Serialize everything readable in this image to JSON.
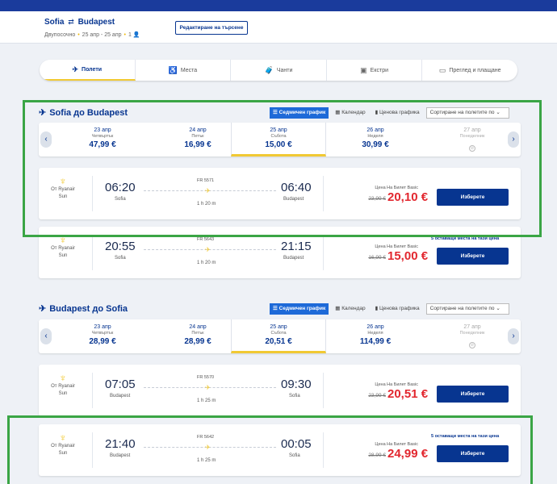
{
  "header": {
    "from": "Sofia",
    "to": "Budapest",
    "arrows": "⇄",
    "trip_type": "Двупосочно",
    "dates": "25 апр - 25 апр",
    "pax": "1",
    "edit_label": "Редактиране на търсене"
  },
  "steps": [
    {
      "label": "Полети",
      "icon": "plane-icon"
    },
    {
      "label": "Места",
      "icon": "seat-icon"
    },
    {
      "label": "Чанти",
      "icon": "bag-icon"
    },
    {
      "label": "Екстри",
      "icon": "extras-icon"
    },
    {
      "label": "Преглед и плащане",
      "icon": "card-icon"
    }
  ],
  "outbound": {
    "title": "Sofia до Budapest",
    "tools": {
      "weekly": "Седмичен график",
      "calendar": "Календар",
      "price_chart": "Ценова графика",
      "sort": "Сортиране на полетите по"
    },
    "dates": [
      {
        "date": "23 апр",
        "weekday": "Четвъртък",
        "price": "47,99 €"
      },
      {
        "date": "24 апр",
        "weekday": "Петък",
        "price": "16,99 €"
      },
      {
        "date": "25 апр",
        "weekday": "Събота",
        "price": "15,00 €"
      },
      {
        "date": "26 апр",
        "weekday": "Неделя",
        "price": "30,99 €"
      },
      {
        "date": "27 апр",
        "weekday": "Понеделник",
        "price": ""
      }
    ],
    "flights": [
      {
        "airline": "От Ryanair",
        "airline2": "Sun",
        "dep": "06:20",
        "from": "Sofia",
        "arr": "06:40",
        "to": "Budapest",
        "number": "FR 5571",
        "duration": "1 h 20 m",
        "fare_label": "Цена На Билет Basic",
        "old": "23,99 €",
        "price": "20,10 €",
        "seats": "",
        "button": "Изберете"
      },
      {
        "airline": "От Ryanair",
        "airline2": "Sun",
        "dep": "20:55",
        "from": "Sofia",
        "arr": "21:15",
        "to": "Budapest",
        "number": "FR 5643",
        "duration": "1 h 20 m",
        "fare_label": "Цена На Билет Basic",
        "old": "16,99 €",
        "price": "15,00 €",
        "seats": "5 оставащи места на тази цена",
        "button": "Изберете"
      }
    ]
  },
  "inbound": {
    "title": "Budapest до Sofia",
    "tools": {
      "weekly": "Седмичен график",
      "calendar": "Календар",
      "price_chart": "Ценова графика",
      "sort": "Сортиране на полетите по"
    },
    "dates": [
      {
        "date": "23 апр",
        "weekday": "Четвъртък",
        "price": "28,99 €"
      },
      {
        "date": "24 апр",
        "weekday": "Петък",
        "price": "28,99 €"
      },
      {
        "date": "25 апр",
        "weekday": "Събота",
        "price": "20,51 €"
      },
      {
        "date": "26 апр",
        "weekday": "Неделя",
        "price": "114,99 €"
      },
      {
        "date": "27 апр",
        "weekday": "Понеделник",
        "price": ""
      }
    ],
    "flights": [
      {
        "airline": "От Ryanair",
        "airline2": "Sun",
        "dep": "07:05",
        "from": "Budapest",
        "arr": "09:30",
        "to": "Sofia",
        "number": "FR 5570",
        "duration": "1 h 25 m",
        "fare_label": "Цена На Билет Basic",
        "old": "23,99 €",
        "price": "20,51 €",
        "seats": "",
        "button": "Изберете"
      },
      {
        "airline": "От Ryanair",
        "airline2": "Sun",
        "dep": "21:40",
        "from": "Budapest",
        "arr": "00:05",
        "to": "Sofia",
        "number": "FR 5642",
        "duration": "1 h 25 m",
        "fare_label": "Цена На Билет Basic",
        "old": "28,99 €",
        "price": "24,99 €",
        "seats": "5 оставащи места на тази цена",
        "button": "Изберете"
      }
    ]
  },
  "colors": {
    "brand": "#073590",
    "accent": "#f1c933",
    "price": "#e2272f",
    "highlight": "#3aa545"
  }
}
